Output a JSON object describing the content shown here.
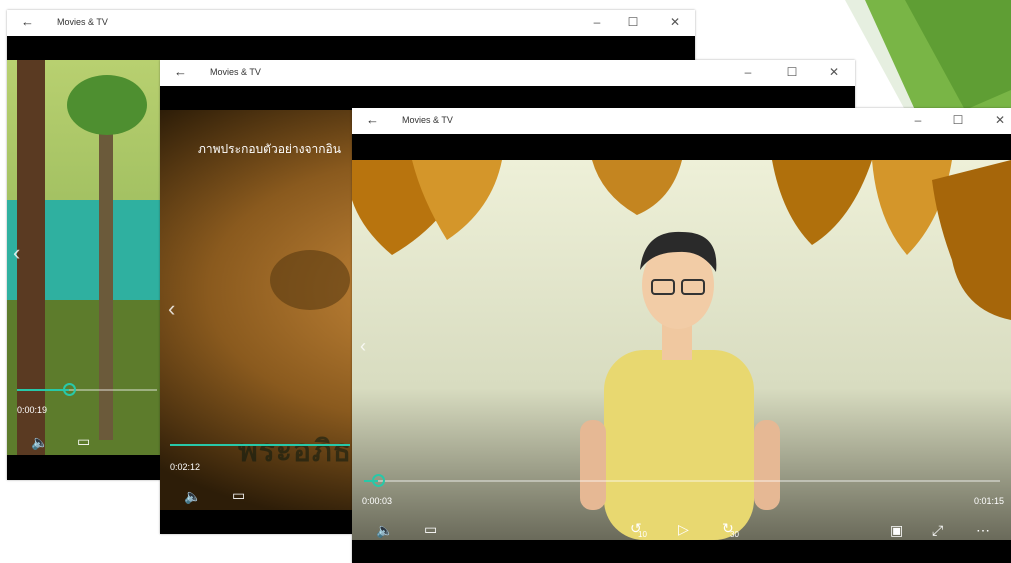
{
  "app": {
    "title": "Movies & TV"
  },
  "icons": {
    "back": "arrow-left-icon",
    "minimize": "minimize-icon",
    "maximize": "maximize-icon",
    "close": "close-icon",
    "volume": "volume-icon",
    "captions": "captions-icon",
    "replay10": "replay-10-icon",
    "play": "play-icon",
    "forward30": "forward-30-icon",
    "cast": "cast-icon",
    "fullscreen": "fullscreen-icon",
    "more": "more-icon"
  },
  "windows": [
    {
      "title": "Movies & TV",
      "time_current": "0:00:19",
      "progress": 0.38
    },
    {
      "title": "Movies & TV",
      "time_current": "0:02:12",
      "subtitle": "ภาพประกอบตัวอย่างจากอิน",
      "caption_overlay": "พระอภิธ",
      "progress": 0.95
    },
    {
      "title": "Movies & TV",
      "time_current": "0:00:03",
      "time_total": "0:01:15",
      "progress": 0.03,
      "replay_label": "10",
      "forward_label": "30"
    }
  ],
  "colors": {
    "accent": "#28c8a8",
    "deco_green": "#6aa83a"
  }
}
